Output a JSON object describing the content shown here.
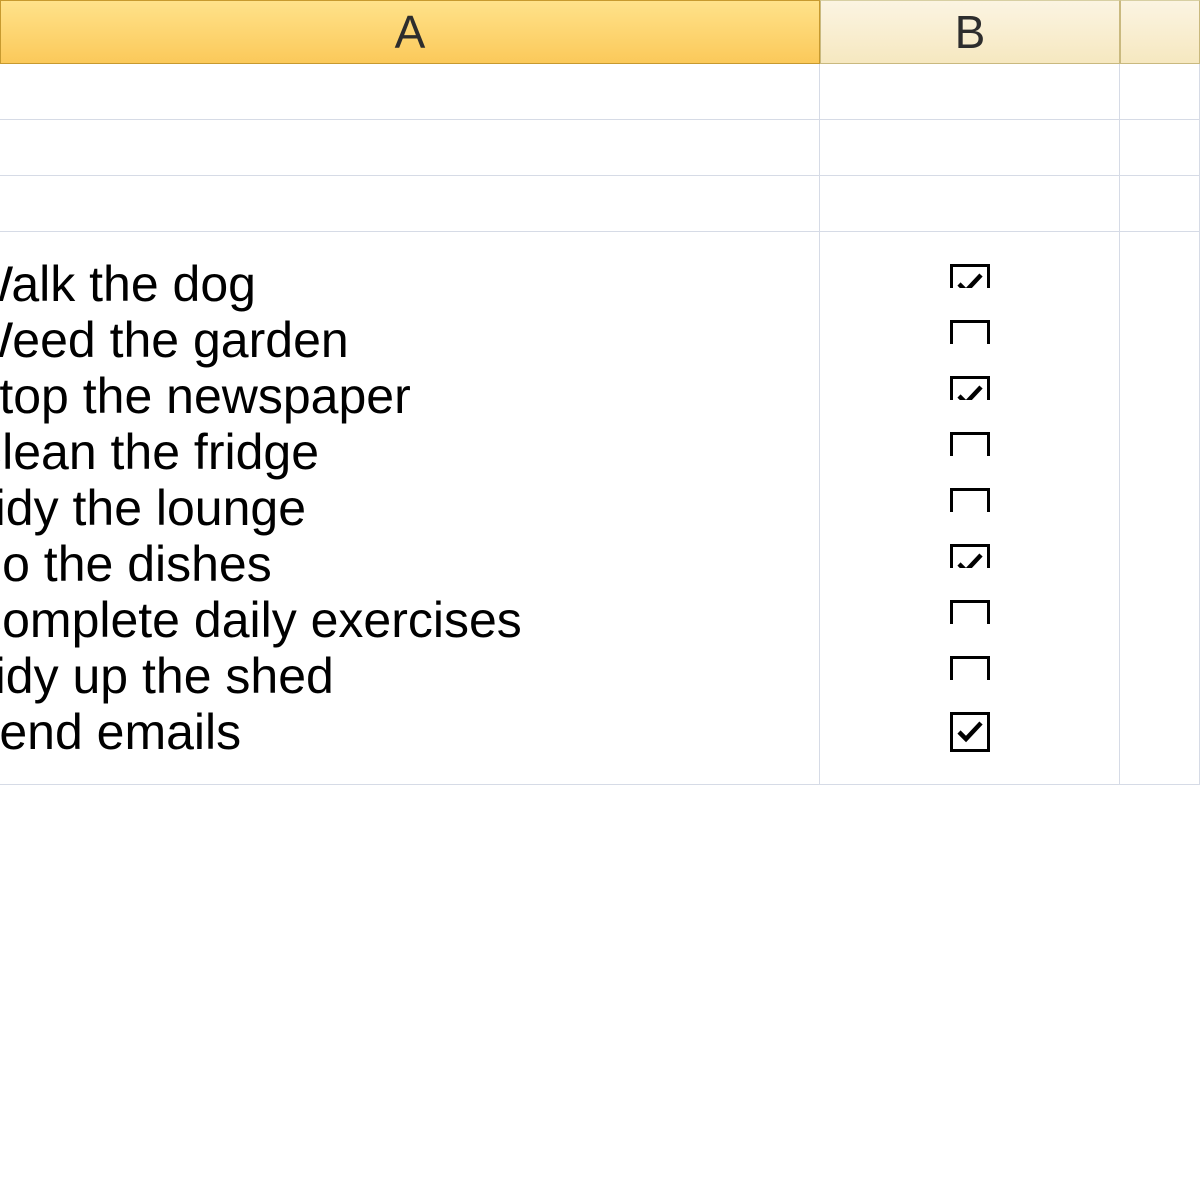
{
  "columns": {
    "A": "A",
    "B": "B",
    "C": ""
  },
  "rows": [
    {
      "text": "",
      "checkbox": null,
      "tall": false
    },
    {
      "text": "",
      "checkbox": null,
      "tall": false
    },
    {
      "text": "",
      "checkbox": null,
      "tall": false
    },
    {
      "text": "Walk the dog",
      "checkbox": true,
      "tall": true
    },
    {
      "text": "Weed the garden",
      "checkbox": false,
      "tall": true
    },
    {
      "text": "Stop the newspaper",
      "checkbox": true,
      "tall": true
    },
    {
      "text": "Clean the fridge",
      "checkbox": false,
      "tall": true
    },
    {
      "text": "Tidy the lounge",
      "checkbox": false,
      "tall": true
    },
    {
      "text": "Do the dishes",
      "checkbox": true,
      "tall": true
    },
    {
      "text": "Complete daily exercises",
      "checkbox": false,
      "tall": true
    },
    {
      "text": "Tidy up the shed",
      "checkbox": false,
      "tall": true
    },
    {
      "text": "Send emails",
      "checkbox": true,
      "tall": true
    }
  ]
}
